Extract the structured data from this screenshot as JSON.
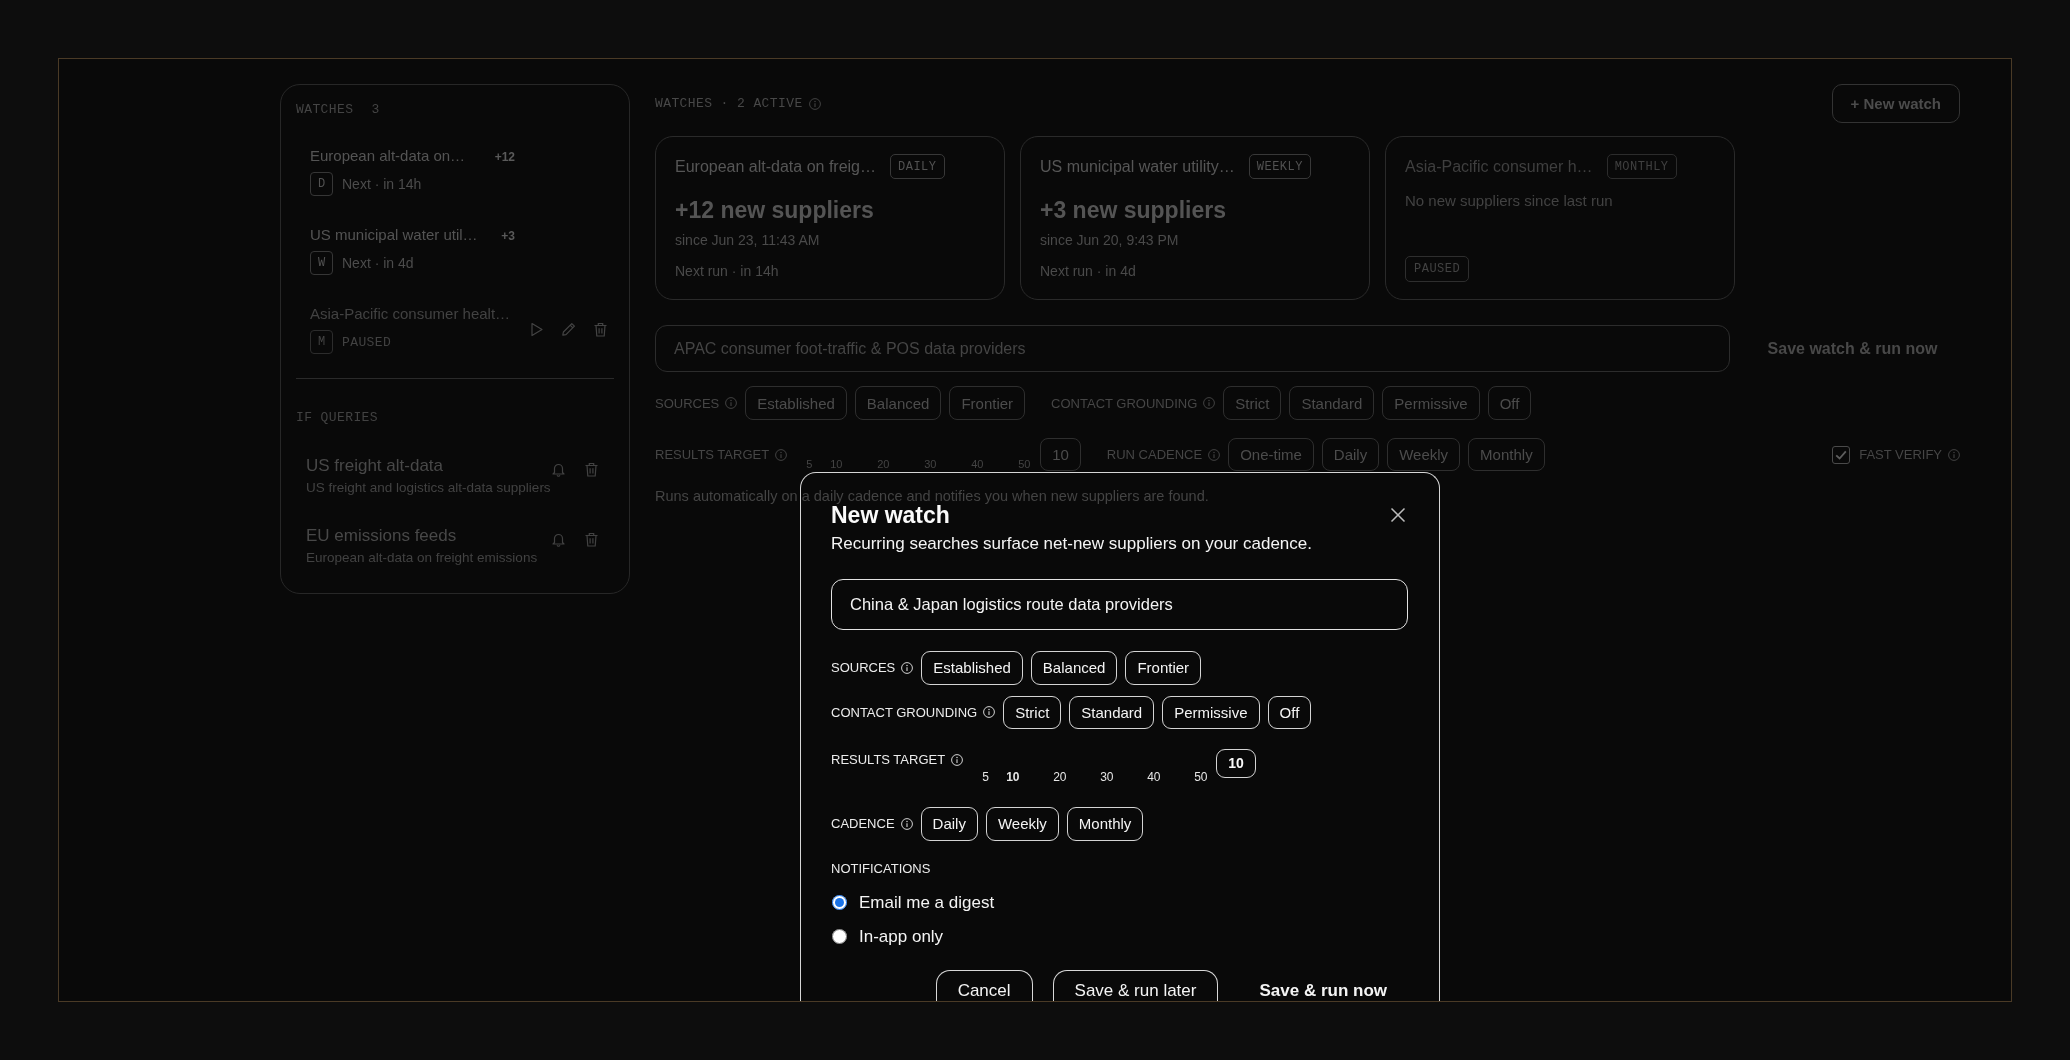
{
  "sidebar": {
    "watches_heading": "WATCHES",
    "watches_count": "3",
    "watches": [
      {
        "title": "European alt-data on…",
        "new_count": "+12",
        "cadence": "D",
        "status": "Next · in 14h",
        "paused": false,
        "hovered": false
      },
      {
        "title": "US municipal water util…",
        "new_count": "+3",
        "cadence": "W",
        "status": "Next · in 4d",
        "paused": false,
        "hovered": false
      },
      {
        "title": "Asia-Pacific consumer healt…",
        "cadence": "M",
        "status": "PAUSED",
        "paused": true,
        "hovered": true
      }
    ],
    "queries_heading": "IF QUERIES",
    "queries": [
      {
        "title": "US freight alt-data",
        "subtitle": "US freight and logistics alt-data suppliers"
      },
      {
        "title": "EU emissions feeds",
        "subtitle": "European alt-data on freight emissions"
      }
    ]
  },
  "main": {
    "heading": "WATCHES · 2 ACTIVE",
    "new_watch_button": "+ New watch",
    "cards": [
      {
        "title": "European alt-data on freig…",
        "cadence": "DAILY",
        "new_suppliers": "+12 new suppliers",
        "since": "since Jun 23, 11:43 AM",
        "next_run": "Next run · in 14h",
        "paused": false
      },
      {
        "title": "US municipal water utility…",
        "cadence": "WEEKLY",
        "new_suppliers": "+3 new suppliers",
        "since": "since Jun 20, 9:43 PM",
        "next_run": "Next run · in 4d",
        "paused": false
      },
      {
        "title": "Asia-Pacific consumer h…",
        "cadence": "MONTHLY",
        "summary": "No new suppliers since last run",
        "status": "PAUSED",
        "paused": true
      }
    ],
    "form": {
      "query": "APAC consumer foot-traffic & POS data providers",
      "submit": "Save watch & run now",
      "sources": {
        "label": "SOURCES",
        "options": [
          {
            "label": "Established",
            "selected": false
          },
          {
            "label": "Balanced",
            "selected": false
          },
          {
            "label": "Frontier",
            "selected": false
          }
        ]
      },
      "contact_grounding": {
        "label": "CONTACT GROUNDING",
        "options": [
          {
            "label": "Strict",
            "selected": false
          },
          {
            "label": "Standard",
            "selected": false
          },
          {
            "label": "Permissive",
            "selected": false
          },
          {
            "label": "Off",
            "selected": false
          }
        ]
      },
      "results_target": {
        "label": "RESULTS TARGET",
        "ticks": [
          {
            "label": "5"
          },
          {
            "label": "10"
          },
          {
            "label": "20"
          },
          {
            "label": "30"
          },
          {
            "label": "40"
          },
          {
            "label": "50"
          }
        ],
        "value": "10"
      },
      "run_cadence": {
        "label": "RUN CADENCE",
        "options": [
          {
            "label": "One-time",
            "selected": false
          },
          {
            "label": "Daily",
            "selected": false
          },
          {
            "label": "Weekly",
            "selected": false
          },
          {
            "label": "Monthly",
            "selected": false
          }
        ]
      },
      "fast_verify": {
        "label": "FAST VERIFY",
        "checked": true
      },
      "note": "Runs automatically on a daily cadence and notifies you when new suppliers are found."
    }
  },
  "modal": {
    "title": "New watch",
    "subtitle": "Recurring searches surface net-new suppliers on your cadence.",
    "query": "China & Japan logistics route data providers",
    "sources": {
      "label": "SOURCES",
      "options": [
        {
          "label": "Established",
          "selected": false
        },
        {
          "label": "Balanced",
          "selected": false
        },
        {
          "label": "Frontier",
          "selected": false
        }
      ]
    },
    "contact_grounding": {
      "label": "CONTACT GROUNDING",
      "options": [
        {
          "label": "Strict",
          "selected": false
        },
        {
          "label": "Standard",
          "selected": false
        },
        {
          "label": "Permissive",
          "selected": false
        },
        {
          "label": "Off",
          "selected": false
        }
      ]
    },
    "results_target": {
      "label": "RESULTS TARGET",
      "ticks": [
        {
          "label": "5",
          "selected": false
        },
        {
          "label": "10",
          "selected": true
        },
        {
          "label": "20",
          "selected": false
        },
        {
          "label": "30",
          "selected": false
        },
        {
          "label": "40",
          "selected": false
        },
        {
          "label": "50",
          "selected": false
        }
      ],
      "value": "10"
    },
    "cadence": {
      "label": "CADENCE",
      "options": [
        {
          "label": "Daily",
          "selected": false
        },
        {
          "label": "Weekly",
          "selected": false
        },
        {
          "label": "Monthly",
          "selected": false
        }
      ]
    },
    "notifications": {
      "label": "NOTIFICATIONS",
      "options": [
        {
          "label": "Email me a digest",
          "selected": true
        },
        {
          "label": "In-app only",
          "selected": false
        }
      ]
    },
    "buttons": [
      {
        "label": "Cancel",
        "kind": "secondary"
      },
      {
        "label": "Save & run later",
        "kind": "secondary"
      },
      {
        "label": "Save & run now",
        "kind": "primary"
      }
    ]
  }
}
